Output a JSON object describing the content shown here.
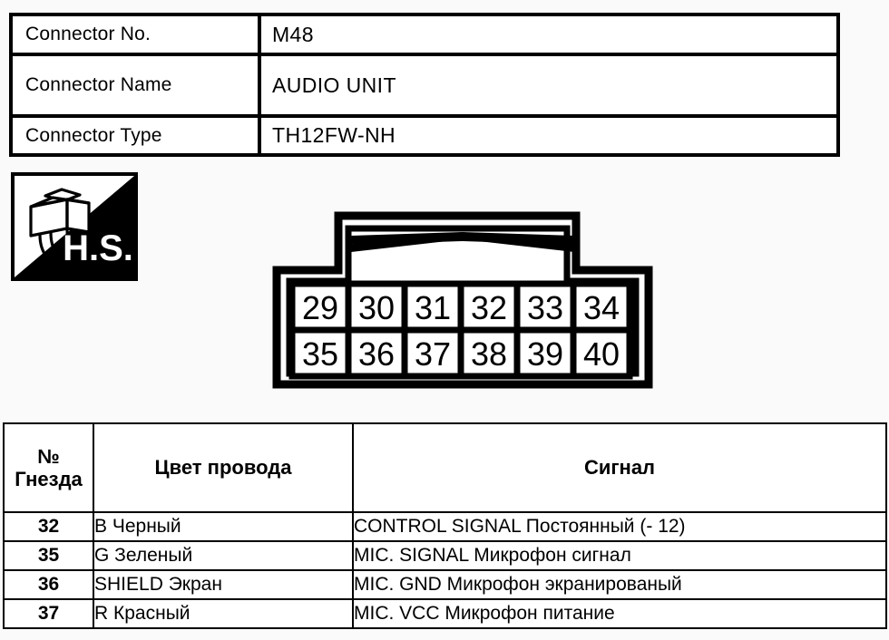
{
  "header": {
    "rows": [
      {
        "label": "Connector No.",
        "value": "M48"
      },
      {
        "label": "Connector Name",
        "value": "AUDIO UNIT"
      },
      {
        "label": "Connector Type",
        "value": "TH12FW-NH"
      }
    ]
  },
  "badge": {
    "text": "H.S.",
    "icon": "connector-harness-icon"
  },
  "connector": {
    "top_row": [
      "29",
      "30",
      "31",
      "32",
      "33",
      "34"
    ],
    "bottom_row": [
      "35",
      "36",
      "37",
      "38",
      "39",
      "40"
    ]
  },
  "pin_table": {
    "columns": [
      "№\nГнезда",
      "Цвет провода",
      "Сигнал"
    ],
    "column_no_line1": "№",
    "column_no_line2": "Гнезда",
    "column_color": "Цвет провода",
    "column_signal": "Сигнал",
    "rows": [
      {
        "no": "32",
        "color": "B Черный",
        "signal": "CONTROL SIGNAL Постоянный (- 12)"
      },
      {
        "no": "35",
        "color": "G Зеленый",
        "signal": "MIC. SIGNAL Микрофон сигнал"
      },
      {
        "no": "36",
        "color": "SHIELD Экран",
        "signal": "MIC. GND Микрофон экранированый"
      },
      {
        "no": "37",
        "color": "R Красный",
        "signal": "MIC. VCC Микрофон питание"
      }
    ]
  },
  "colors": {
    "ink": "#000000",
    "paper": "#ffffff",
    "background": "#fafafa"
  }
}
